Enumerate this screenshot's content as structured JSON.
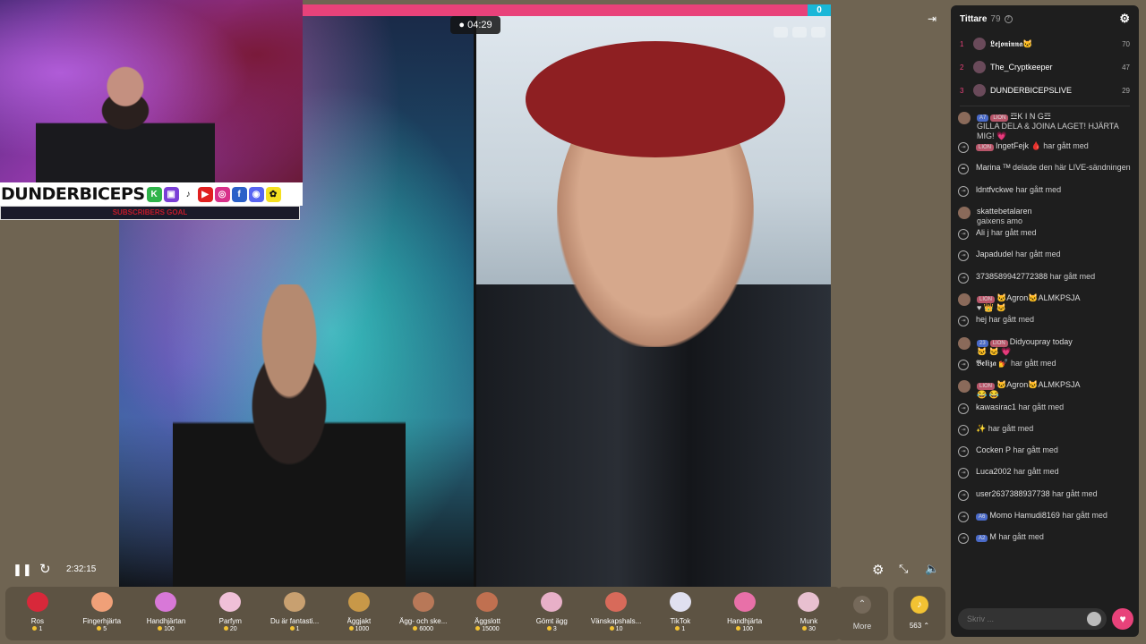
{
  "stream": {
    "timer": "04:29",
    "top_bar_count": "0",
    "elapsed": "2:32:15"
  },
  "overlay": {
    "brand_name": "DUNDERBICEPS",
    "social_icons": [
      "k-icon",
      "twitch-icon",
      "tiktok-icon",
      "youtube-icon",
      "instagram-icon",
      "facebook-icon",
      "discord-icon",
      "snapchat-icon"
    ],
    "sub_goal_text": "SUBSCRIBERS GOAL"
  },
  "gifts": [
    {
      "name": "Ros",
      "price": "1"
    },
    {
      "name": "Fingerhjärta",
      "price": "5"
    },
    {
      "name": "Handhjärtan",
      "price": "100"
    },
    {
      "name": "Parfym",
      "price": "20"
    },
    {
      "name": "Du är fantasti...",
      "price": "1"
    },
    {
      "name": "Äggjakt",
      "price": "1000"
    },
    {
      "name": "Ägg- och ske...",
      "price": "6000"
    },
    {
      "name": "Äggslott",
      "price": "15000"
    },
    {
      "name": "Gömt ägg",
      "price": "3"
    },
    {
      "name": "Vänskapshals...",
      "price": "10"
    },
    {
      "name": "TikTok",
      "price": "1"
    },
    {
      "name": "Handhjärta",
      "price": "100"
    },
    {
      "name": "Munk",
      "price": "30"
    }
  ],
  "more_label": "More",
  "coins_label": "563",
  "chat": {
    "title": "Tittare",
    "viewer_count": "79",
    "top_viewers": [
      {
        "rank": "1",
        "name": "𝕷𝖊𝖏𝖔𝖓𝖎𝖓𝖓𝖆🐱",
        "score": "70"
      },
      {
        "rank": "2",
        "name": "The_Cryptkeeper",
        "score": "47"
      },
      {
        "rank": "3",
        "name": "DUNDERBICEPSLIVE",
        "score": "29"
      }
    ],
    "messages": [
      {
        "kind": "avatar",
        "badges": [
          "A7",
          "LION"
        ],
        "user": "☲K I N G☲",
        "text": "GILLA DELA & JOINA LAGET! HJÄRTA MIG! 💗"
      },
      {
        "kind": "join",
        "badges": [
          "LION"
        ],
        "user": "IngetFejk 🩸",
        "text": "har gått med"
      },
      {
        "kind": "share",
        "badges": [],
        "user": "Marina ᵀᴹ",
        "text": "delade den här LIVE-sändningen"
      },
      {
        "kind": "join",
        "badges": [],
        "user": "ldntfvckwe",
        "text": "har gått med"
      },
      {
        "kind": "avatar",
        "badges": [],
        "user": "skattebetalaren",
        "text": "gaixens amo"
      },
      {
        "kind": "join",
        "badges": [],
        "user": "Ali j",
        "text": "har gått med"
      },
      {
        "kind": "join",
        "badges": [],
        "user": "Japadudel",
        "text": "har gått med"
      },
      {
        "kind": "join",
        "badges": [],
        "user": "37385899427723​88",
        "text": "har gått med"
      },
      {
        "kind": "avatar",
        "badges": [
          "LION"
        ],
        "user": "🐱Agron🐱ALMKPSJA",
        "text": "♥ 👑 🐱"
      },
      {
        "kind": "join",
        "badges": [],
        "user": "hej",
        "text": "har gått med"
      },
      {
        "kind": "avatar",
        "badges": [
          "23",
          "LION"
        ],
        "user": "Didyoupray today",
        "text": "🐱 🐱 💗"
      },
      {
        "kind": "join",
        "badges": [],
        "user": "𝕭𝖊𝖑𝖎𝖟𝖆 💅",
        "text": "har gått med"
      },
      {
        "kind": "avatar",
        "badges": [
          "LION"
        ],
        "user": "🐱Agron🐱ALMKPSJA",
        "text": "😂 😂"
      },
      {
        "kind": "join",
        "badges": [],
        "user": "kawasirac1",
        "text": "har gått med"
      },
      {
        "kind": "join",
        "badges": [],
        "user": "✨",
        "text": "har gått med"
      },
      {
        "kind": "join",
        "badges": [],
        "user": "Cocken P",
        "text": "har gått med"
      },
      {
        "kind": "join",
        "badges": [],
        "user": "Luca2002",
        "text": "har gått med"
      },
      {
        "kind": "join",
        "badges": [],
        "user": "user2637388937738",
        "text": "har gått med"
      },
      {
        "kind": "join",
        "badges": [
          "A6"
        ],
        "user": "Momo Hamudi8169",
        "text": "har gått med"
      },
      {
        "kind": "join",
        "badges": [
          "A2"
        ],
        "user": "M",
        "text": "har gått med"
      }
    ],
    "input_placeholder": "Skriv ..."
  }
}
